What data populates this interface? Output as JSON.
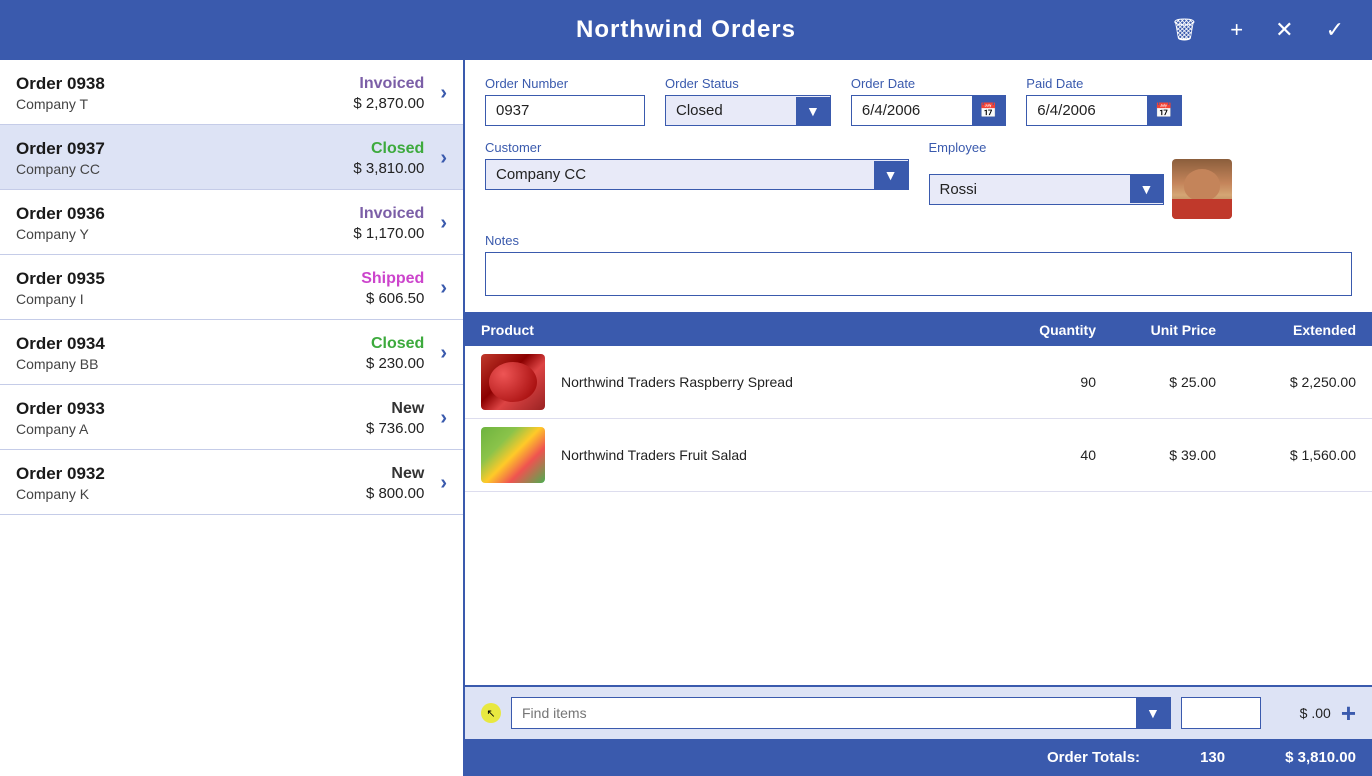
{
  "app": {
    "title": "Northwind Orders",
    "icons": {
      "delete": "🗑",
      "add": "+",
      "cancel": "✕",
      "confirm": "✓"
    }
  },
  "orders": [
    {
      "id": "0938",
      "company": "Company T",
      "status": "Invoiced",
      "amount": "$ 2,870.00",
      "statusClass": "status-invoiced"
    },
    {
      "id": "0937",
      "company": "Company CC",
      "status": "Closed",
      "amount": "$ 3,810.00",
      "statusClass": "status-closed",
      "selected": true
    },
    {
      "id": "0936",
      "company": "Company Y",
      "status": "Invoiced",
      "amount": "$ 1,170.00",
      "statusClass": "status-invoiced"
    },
    {
      "id": "0935",
      "company": "Company I",
      "status": "Shipped",
      "amount": "$ 606.50",
      "statusClass": "status-shipped"
    },
    {
      "id": "0934",
      "company": "Company BB",
      "status": "Closed",
      "amount": "$ 230.00",
      "statusClass": "status-closed"
    },
    {
      "id": "0933",
      "company": "Company A",
      "status": "New",
      "amount": "$ 736.00",
      "statusClass": "status-new"
    },
    {
      "id": "0932",
      "company": "Company K",
      "status": "New",
      "amount": "$ 800.00",
      "statusClass": "status-new"
    }
  ],
  "detail": {
    "order_number_label": "Order Number",
    "order_number_value": "0937",
    "order_status_label": "Order Status",
    "order_status_value": "Closed",
    "order_date_label": "Order Date",
    "order_date_value": "6/4/2006",
    "paid_date_label": "Paid Date",
    "paid_date_value": "6/4/2006",
    "customer_label": "Customer",
    "customer_value": "Company CC",
    "employee_label": "Employee",
    "employee_value": "Rossi",
    "notes_label": "Notes",
    "notes_value": ""
  },
  "products_table": {
    "col_product": "Product",
    "col_quantity": "Quantity",
    "col_unit_price": "Unit Price",
    "col_extended": "Extended",
    "rows": [
      {
        "name": "Northwind Traders Raspberry Spread",
        "quantity": "90",
        "unit_price": "$ 25.00",
        "extended": "$ 2,250.00"
      },
      {
        "name": "Northwind Traders Fruit Salad",
        "quantity": "40",
        "unit_price": "$ 39.00",
        "extended": "$ 1,560.00"
      }
    ]
  },
  "add_row": {
    "find_placeholder": "Find items",
    "qty_value": "",
    "price_display": "$ .00"
  },
  "totals": {
    "label": "Order Totals:",
    "quantity": "130",
    "amount": "$ 3,810.00"
  }
}
